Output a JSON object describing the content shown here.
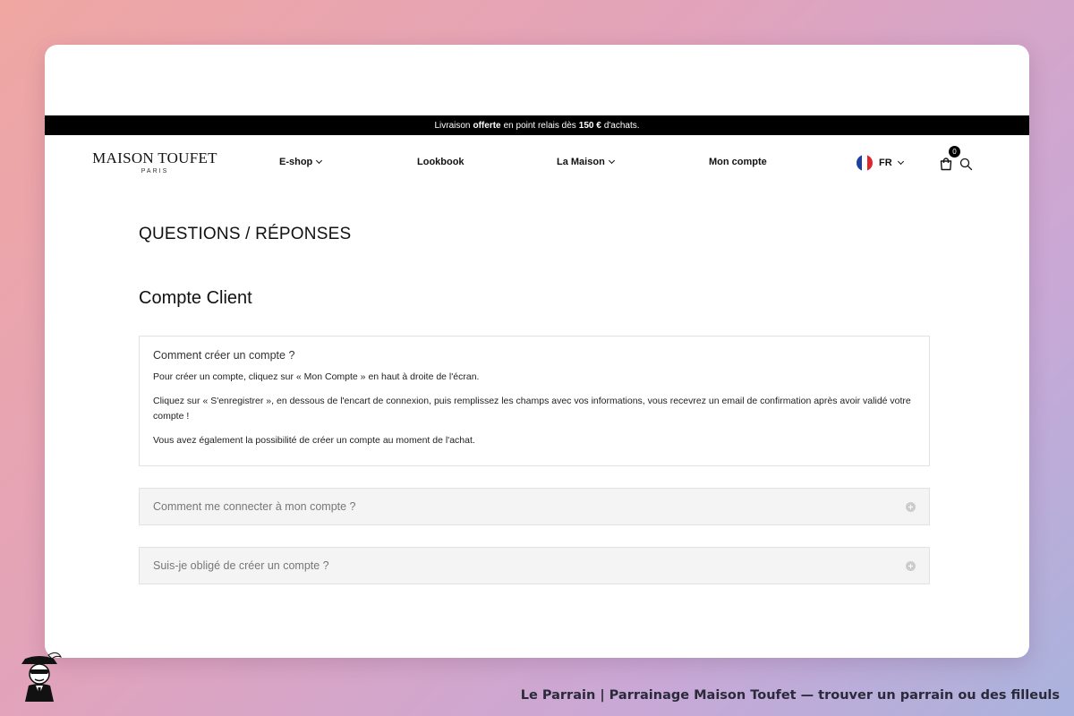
{
  "promo": {
    "prefix": "Livraison",
    "highlight": "offerte",
    "middle": "en point relais dès",
    "amount": "150 €",
    "suffix": "d'achats."
  },
  "header": {
    "brand": "MAISON TOUFET",
    "city": "PARIS",
    "nav": [
      {
        "label": "E-shop",
        "has_dropdown": true
      },
      {
        "label": "Lookbook",
        "has_dropdown": false
      },
      {
        "label": "La Maison",
        "has_dropdown": true
      },
      {
        "label": "Mon compte",
        "has_dropdown": false
      }
    ],
    "language": "FR",
    "cart_count": "0"
  },
  "main": {
    "page_title": "QUESTIONS / RÉPONSES",
    "section_title": "Compte Client",
    "faq": [
      {
        "question": "Comment créer un compte ?",
        "expanded": true,
        "answer": [
          "Pour créer un compte, cliquez sur « Mon Compte » en haut à droite de l'écran.",
          "Cliquez sur « S'enregistrer », en dessous de l'encart de connexion, puis remplissez les champs avec vos informations, vous recevrez un email de confirmation après avoir validé votre compte !",
          "Vous avez également la possibilité de créer un compte au moment de l'achat."
        ]
      },
      {
        "question": "Comment me connecter à mon compte ?",
        "expanded": false
      },
      {
        "question": "Suis-je obligé de créer un compte ?",
        "expanded": false
      }
    ]
  },
  "footer": {
    "caption": "Le Parrain | Parrainage Maison Toufet — trouver un parrain ou des filleuls"
  },
  "colors": {
    "promo_bg": "#000000",
    "faq_closed_bg": "#f4f4f4",
    "flag": [
      "#1f3fa0",
      "#ffffff",
      "#e0262c"
    ]
  }
}
